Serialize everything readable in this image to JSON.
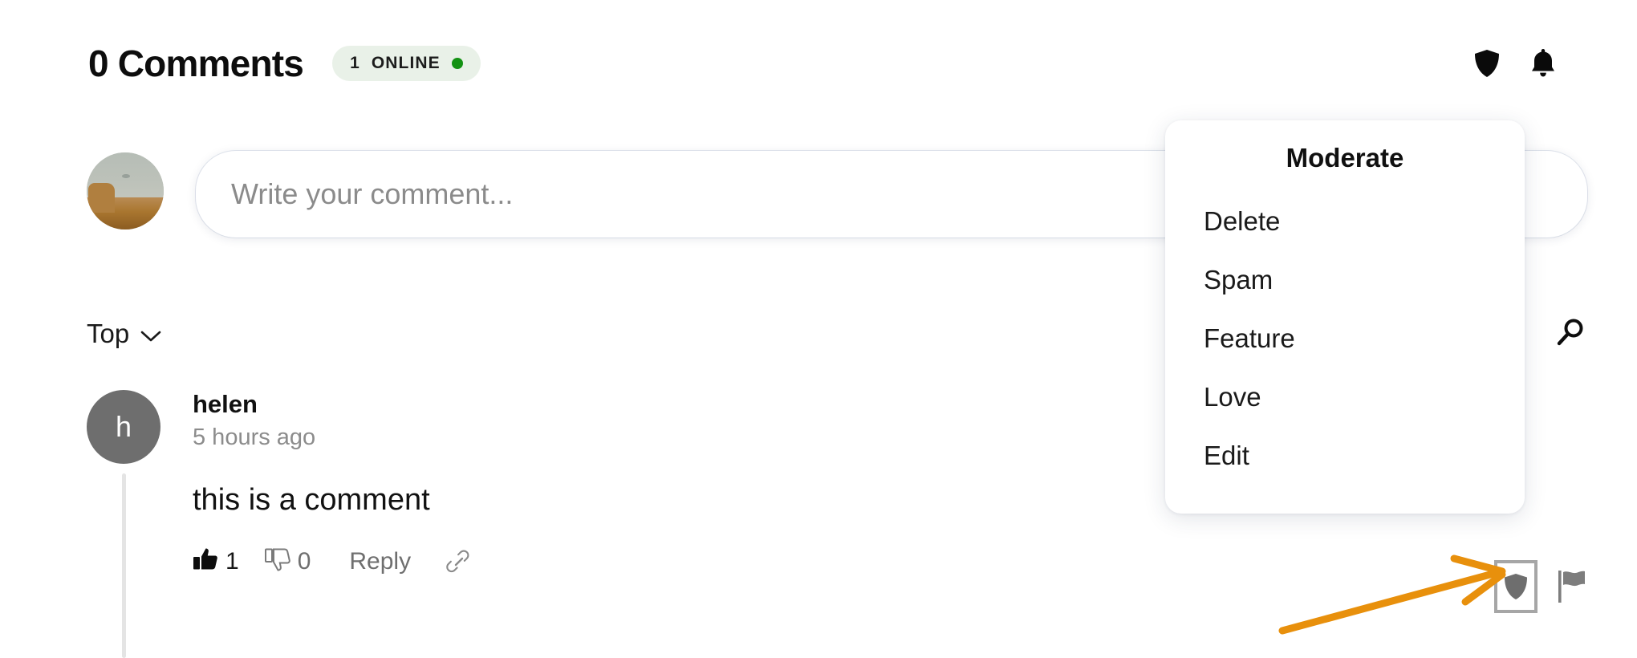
{
  "header": {
    "title": "0 Comments",
    "online_badge": {
      "count": "1",
      "label": "ONLINE",
      "dot_color": "#139213",
      "background": "#e9f1e8"
    },
    "shield_icon": "shield-icon",
    "bell_icon": "bell-icon"
  },
  "composer": {
    "avatar": "user-avatar-photo",
    "placeholder": "Write your comment...",
    "value": ""
  },
  "sort": {
    "label": "Top",
    "chevron_icon": "chevron-down-icon",
    "search_icon": "search-icon"
  },
  "comment": {
    "avatar_initial": "h",
    "author": "helen",
    "timestamp": "5 hours ago",
    "text": "this is a comment",
    "like_icon": "thumbs-up-icon",
    "like_count": "1",
    "dislike_icon": "thumbs-down-icon",
    "dislike_count": "0",
    "reply_label": "Reply",
    "link_icon": "link-icon",
    "moderate_shield_icon": "shield-icon",
    "flag_icon": "flag-icon"
  },
  "moderate_menu": {
    "title": "Moderate",
    "items": [
      {
        "label": "Delete"
      },
      {
        "label": "Spam"
      },
      {
        "label": "Feature"
      },
      {
        "label": "Love"
      },
      {
        "label": "Edit"
      }
    ]
  },
  "annotation": {
    "type": "arrow",
    "color": "#e8900c",
    "points_to": "comment-moderate-shield-button"
  }
}
